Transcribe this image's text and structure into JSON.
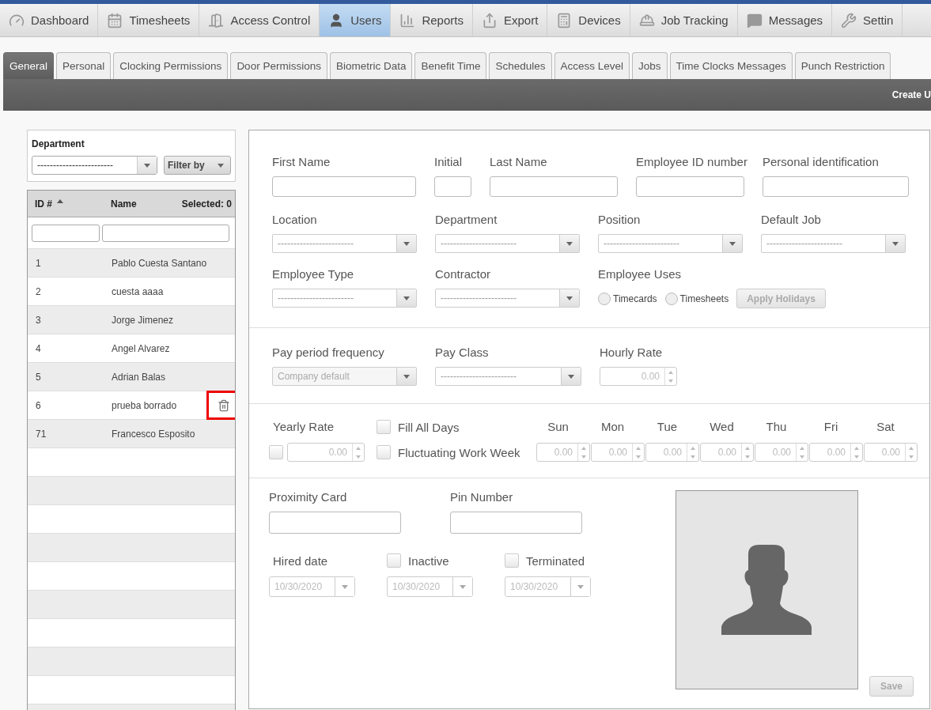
{
  "nav": [
    {
      "label": "Dashboard",
      "selected": false
    },
    {
      "label": "Timesheets",
      "selected": false
    },
    {
      "label": "Access Control",
      "selected": false
    },
    {
      "label": "Users",
      "selected": true
    },
    {
      "label": "Reports",
      "selected": false
    },
    {
      "label": "Export",
      "selected": false
    },
    {
      "label": "Devices",
      "selected": false
    },
    {
      "label": "Job Tracking",
      "selected": false
    },
    {
      "label": "Messages",
      "selected": false
    },
    {
      "label": "Settin",
      "selected": false
    }
  ],
  "tabs": [
    {
      "label": "General",
      "selected": true
    },
    {
      "label": "Personal",
      "selected": false
    },
    {
      "label": "Clocking Permissions",
      "selected": false
    },
    {
      "label": "Door Permissions",
      "selected": false
    },
    {
      "label": "Biometric Data",
      "selected": false
    },
    {
      "label": "Benefit Time",
      "selected": false
    },
    {
      "label": "Schedules",
      "selected": false
    },
    {
      "label": "Access Level",
      "selected": false
    },
    {
      "label": "Jobs",
      "selected": false
    },
    {
      "label": "Time Clocks Messages",
      "selected": false
    },
    {
      "label": "Punch Restriction",
      "selected": false
    }
  ],
  "toolbar": {
    "action": "Create U"
  },
  "department_filter": {
    "label": "Department",
    "placeholder": "------------------------",
    "filter_button": "Filter by"
  },
  "users_table": {
    "columns": [
      "ID #",
      "Name"
    ],
    "selected_count": "Selected: 0",
    "rows": [
      {
        "id": "1",
        "name": "Pablo Cuesta Santano",
        "hovered": false
      },
      {
        "id": "2",
        "name": "cuesta aaaa",
        "hovered": false
      },
      {
        "id": "3",
        "name": "Jorge Jimenez",
        "hovered": false
      },
      {
        "id": "4",
        "name": "Angel Alvarez",
        "hovered": false
      },
      {
        "id": "5",
        "name": "Adrian Balas",
        "hovered": false
      },
      {
        "id": "6",
        "name": "prueba borrado",
        "hovered": true
      },
      {
        "id": "71",
        "name": "Francesco Esposito",
        "hovered": false
      }
    ]
  },
  "personal_fields": [
    {
      "label": "First Name"
    },
    {
      "label": "Initial"
    },
    {
      "label": "Last Name"
    },
    {
      "label": "Employee ID number"
    },
    {
      "label": "Personal identification"
    }
  ],
  "assignment_selects": [
    {
      "label": "Location",
      "placeholder": "------------------------"
    },
    {
      "label": "Department",
      "placeholder": "------------------------"
    },
    {
      "label": "Position",
      "placeholder": "------------------------"
    },
    {
      "label": "Default Job",
      "placeholder": "------------------------"
    },
    {
      "label": "Employee Type",
      "placeholder": "------------------------"
    },
    {
      "label": "Contractor",
      "placeholder": "------------------------"
    }
  ],
  "employee_uses": {
    "label": "Employee Uses",
    "options": [
      {
        "label": "Timecards",
        "selected": false
      },
      {
        "label": "Timesheets",
        "selected": false
      }
    ],
    "button": {
      "label": "Apply Holidays",
      "disabled": true
    }
  },
  "pay": [
    {
      "label": "Pay period frequency",
      "kind": "select",
      "value": "Company default",
      "disabled": true
    },
    {
      "label": "Pay Class",
      "kind": "select",
      "placeholder": "------------------------",
      "disabled": false
    },
    {
      "label": "Hourly Rate",
      "kind": "number",
      "value": "0.00",
      "disabled": true
    }
  ],
  "yearly_rate": {
    "label": "Yearly Rate",
    "checked": false,
    "value": "0.00",
    "disabled": true
  },
  "week_options": [
    {
      "label": "Fill All Days",
      "checked": false
    },
    {
      "label": "Fluctuating Work Week",
      "checked": false
    }
  ],
  "days": [
    {
      "label": "Sun",
      "value": "0.00"
    },
    {
      "label": "Mon",
      "value": "0.00"
    },
    {
      "label": "Tue",
      "value": "0.00"
    },
    {
      "label": "Wed",
      "value": "0.00"
    },
    {
      "label": "Thu",
      "value": "0.00"
    },
    {
      "label": "Fri",
      "value": "0.00"
    },
    {
      "label": "Sat",
      "value": "0.00"
    }
  ],
  "cards": [
    {
      "label": "Proximity Card"
    },
    {
      "label": "Pin Number"
    }
  ],
  "dates": [
    {
      "label": "Hired date",
      "kind": "plain",
      "value": "10/30/2020",
      "disabled": true
    },
    {
      "label": "Inactive",
      "kind": "checkbox",
      "checked": false,
      "value": "10/30/2020",
      "disabled": true
    },
    {
      "label": "Terminated",
      "kind": "checkbox",
      "checked": false,
      "value": "10/30/2020",
      "disabled": true
    }
  ],
  "save": {
    "label": "Save",
    "disabled": true
  }
}
